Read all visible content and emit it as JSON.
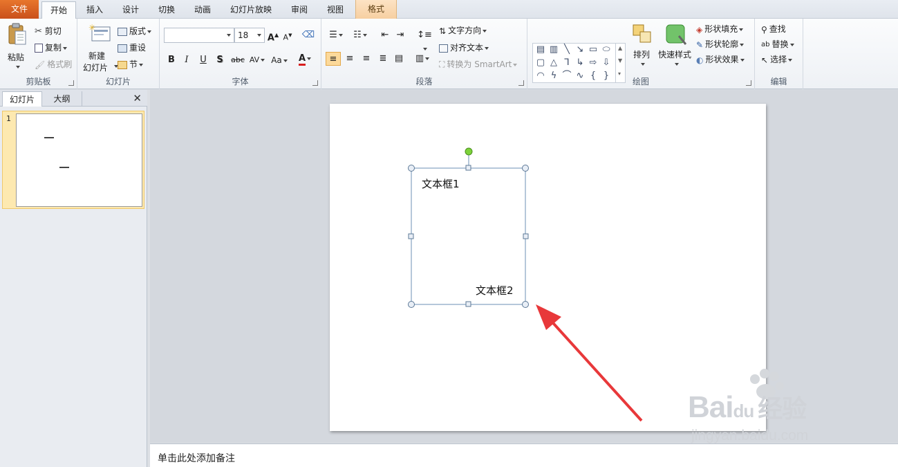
{
  "ribbon_tabs": {
    "file": "文件",
    "home": "开始",
    "insert": "插入",
    "design": "设计",
    "transitions": "切换",
    "animations": "动画",
    "slideshow": "幻灯片放映",
    "review": "审阅",
    "view": "视图",
    "format": "格式"
  },
  "clipboard": {
    "paste": "粘贴",
    "cut": "剪切",
    "copy": "复制",
    "format_painter": "格式刷",
    "label": "剪贴板"
  },
  "slides_group": {
    "new_slide_line1": "新建",
    "new_slide_line2": "幻灯片",
    "layout": "版式",
    "reset": "重设",
    "section": "节",
    "label": "幻灯片"
  },
  "font_group": {
    "font_name": "",
    "font_size": "18",
    "grow": "A",
    "shrink": "A",
    "bold": "B",
    "italic": "I",
    "underline": "U",
    "shadow": "S",
    "strike": "abc",
    "spacing": "AV",
    "case": "Aa",
    "color_a": "A",
    "label": "字体"
  },
  "paragraph_group": {
    "text_direction": "文字方向",
    "align_text": "对齐文本",
    "convert_smartart": "转换为 SmartArt",
    "label": "段落"
  },
  "drawing_group": {
    "arrange": "排列",
    "quick_styles": "快速样式",
    "shape_fill": "形状填充",
    "shape_outline": "形状轮廓",
    "shape_effects": "形状效果",
    "label": "绘图"
  },
  "editing_group": {
    "find": "查找",
    "replace": "替换",
    "select": "选择",
    "label": "编辑"
  },
  "left_panel": {
    "tab_slides": "幻灯片",
    "tab_outline": "大纲",
    "close": "✕",
    "slide_number": "1"
  },
  "slide": {
    "textbox1": "文本框1",
    "textbox2": "文本框2"
  },
  "notes": {
    "placeholder": "单击此处添加备注"
  },
  "watermark": {
    "brand": "Bai",
    "brand_u": "du",
    "brand_cn": "经验",
    "url": "jingyan.baidu.com"
  },
  "colors": {
    "file_tab": "#d9612a",
    "selection_handle": "#6b8fb6",
    "rotate_handle": "#7cd23a",
    "arrow": "#e8383a"
  }
}
